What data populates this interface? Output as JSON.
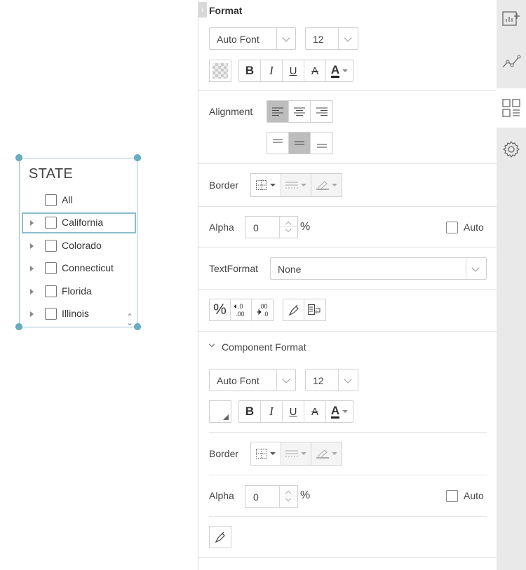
{
  "widget": {
    "title": "STATE",
    "items": [
      {
        "label": "All",
        "expandable": false
      },
      {
        "label": "California",
        "expandable": true
      },
      {
        "label": "Colorado",
        "expandable": true
      },
      {
        "label": "Connecticut",
        "expandable": true
      },
      {
        "label": "Florida",
        "expandable": true
      },
      {
        "label": "Illinois",
        "expandable": true
      }
    ]
  },
  "format": {
    "title": "Format",
    "font": "Auto Font",
    "size": "12",
    "alignment_label": "Alignment",
    "border_label": "Border",
    "alpha_label": "Alpha",
    "alpha_value": "0",
    "percent": "%",
    "auto_label": "Auto",
    "textformat_label": "TextFormat",
    "textformat_value": "None",
    "bold": "B",
    "italic": "I",
    "underline": "U",
    "strike": "A",
    "fontcolor": "A",
    "percent_btn": "%"
  },
  "component_format": {
    "title": "Component Format",
    "font": "Auto Font",
    "size": "12",
    "bold": "B",
    "italic": "I",
    "underline": "U",
    "strike": "A",
    "fontcolor": "A",
    "border_label": "Border",
    "alpha_label": "Alpha",
    "alpha_value": "0",
    "percent": "%",
    "auto_label": "Auto"
  },
  "colors": {
    "selection": "#6aaec2",
    "active_button": "#bdbdbd",
    "side_tab_bg": "#e9e9e9"
  },
  "side_tabs": [
    "add-chart-icon",
    "line-chart-icon",
    "layout-icon",
    "settings-icon"
  ]
}
